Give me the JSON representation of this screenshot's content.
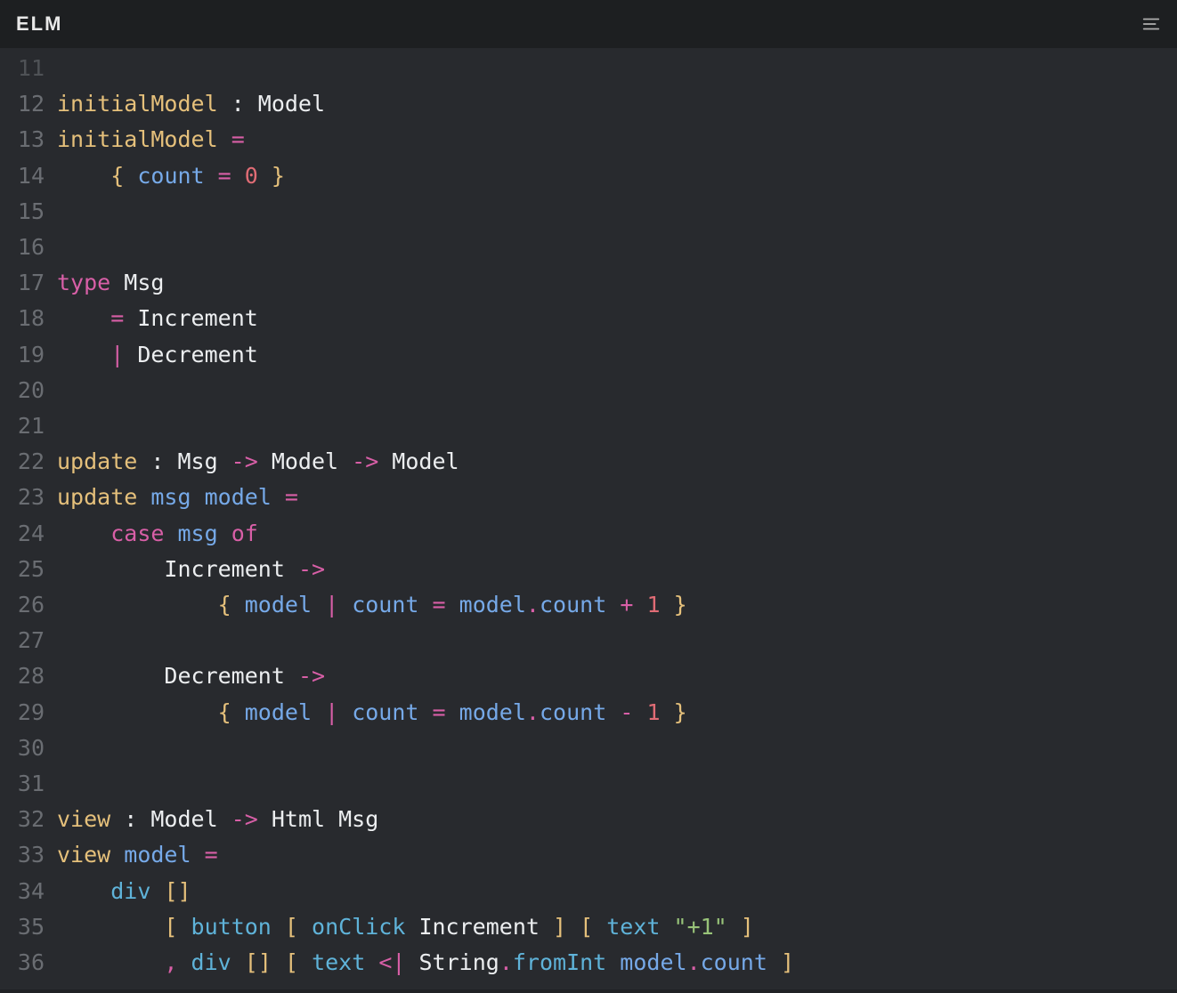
{
  "header": {
    "title": "ELM"
  },
  "lines": [
    {
      "n": "11",
      "cut": true,
      "tokens": []
    },
    {
      "n": "12",
      "tokens": [
        {
          "c": "c-fn",
          "t": "initialModel"
        },
        {
          "c": "c-plain",
          "t": " : "
        },
        {
          "c": "c-plain",
          "t": "Model"
        }
      ]
    },
    {
      "n": "13",
      "tokens": [
        {
          "c": "c-fn",
          "t": "initialModel"
        },
        {
          "c": "c-plain",
          "t": " "
        },
        {
          "c": "c-op",
          "t": "="
        }
      ]
    },
    {
      "n": "14",
      "tokens": [
        {
          "c": "c-plain",
          "t": "    "
        },
        {
          "c": "c-brace",
          "t": "{"
        },
        {
          "c": "c-plain",
          "t": " "
        },
        {
          "c": "c-param",
          "t": "count"
        },
        {
          "c": "c-plain",
          "t": " "
        },
        {
          "c": "c-op",
          "t": "="
        },
        {
          "c": "c-plain",
          "t": " "
        },
        {
          "c": "c-num",
          "t": "0"
        },
        {
          "c": "c-plain",
          "t": " "
        },
        {
          "c": "c-brace",
          "t": "}"
        }
      ]
    },
    {
      "n": "15",
      "tokens": []
    },
    {
      "n": "16",
      "tokens": []
    },
    {
      "n": "17",
      "tokens": [
        {
          "c": "c-key",
          "t": "type"
        },
        {
          "c": "c-plain",
          "t": " Msg"
        }
      ]
    },
    {
      "n": "18",
      "tokens": [
        {
          "c": "c-plain",
          "t": "    "
        },
        {
          "c": "c-op",
          "t": "="
        },
        {
          "c": "c-plain",
          "t": " Increment"
        }
      ]
    },
    {
      "n": "19",
      "tokens": [
        {
          "c": "c-plain",
          "t": "    "
        },
        {
          "c": "c-op",
          "t": "|"
        },
        {
          "c": "c-plain",
          "t": " Decrement"
        }
      ]
    },
    {
      "n": "20",
      "tokens": []
    },
    {
      "n": "21",
      "tokens": []
    },
    {
      "n": "22",
      "tokens": [
        {
          "c": "c-fn",
          "t": "update"
        },
        {
          "c": "c-plain",
          "t": " : Msg "
        },
        {
          "c": "c-op",
          "t": "->"
        },
        {
          "c": "c-plain",
          "t": " Model "
        },
        {
          "c": "c-op",
          "t": "->"
        },
        {
          "c": "c-plain",
          "t": " Model"
        }
      ]
    },
    {
      "n": "23",
      "tokens": [
        {
          "c": "c-fn",
          "t": "update"
        },
        {
          "c": "c-plain",
          "t": " "
        },
        {
          "c": "c-param",
          "t": "msg"
        },
        {
          "c": "c-plain",
          "t": " "
        },
        {
          "c": "c-param",
          "t": "model"
        },
        {
          "c": "c-plain",
          "t": " "
        },
        {
          "c": "c-op",
          "t": "="
        }
      ]
    },
    {
      "n": "24",
      "tokens": [
        {
          "c": "c-plain",
          "t": "    "
        },
        {
          "c": "c-key",
          "t": "case"
        },
        {
          "c": "c-plain",
          "t": " "
        },
        {
          "c": "c-param",
          "t": "msg"
        },
        {
          "c": "c-plain",
          "t": " "
        },
        {
          "c": "c-key",
          "t": "of"
        }
      ]
    },
    {
      "n": "25",
      "tokens": [
        {
          "c": "c-plain",
          "t": "        Increment "
        },
        {
          "c": "c-op",
          "t": "->"
        }
      ]
    },
    {
      "n": "26",
      "tokens": [
        {
          "c": "c-plain",
          "t": "            "
        },
        {
          "c": "c-brace",
          "t": "{"
        },
        {
          "c": "c-plain",
          "t": " "
        },
        {
          "c": "c-param",
          "t": "model"
        },
        {
          "c": "c-plain",
          "t": " "
        },
        {
          "c": "c-op",
          "t": "|"
        },
        {
          "c": "c-plain",
          "t": " "
        },
        {
          "c": "c-param",
          "t": "count"
        },
        {
          "c": "c-plain",
          "t": " "
        },
        {
          "c": "c-op",
          "t": "="
        },
        {
          "c": "c-plain",
          "t": " "
        },
        {
          "c": "c-param",
          "t": "model"
        },
        {
          "c": "c-op",
          "t": "."
        },
        {
          "c": "c-param",
          "t": "count"
        },
        {
          "c": "c-plain",
          "t": " "
        },
        {
          "c": "c-op",
          "t": "+"
        },
        {
          "c": "c-plain",
          "t": " "
        },
        {
          "c": "c-num",
          "t": "1"
        },
        {
          "c": "c-plain",
          "t": " "
        },
        {
          "c": "c-brace",
          "t": "}"
        }
      ]
    },
    {
      "n": "27",
      "tokens": []
    },
    {
      "n": "28",
      "tokens": [
        {
          "c": "c-plain",
          "t": "        Decrement "
        },
        {
          "c": "c-op",
          "t": "->"
        }
      ]
    },
    {
      "n": "29",
      "tokens": [
        {
          "c": "c-plain",
          "t": "            "
        },
        {
          "c": "c-brace",
          "t": "{"
        },
        {
          "c": "c-plain",
          "t": " "
        },
        {
          "c": "c-param",
          "t": "model"
        },
        {
          "c": "c-plain",
          "t": " "
        },
        {
          "c": "c-op",
          "t": "|"
        },
        {
          "c": "c-plain",
          "t": " "
        },
        {
          "c": "c-param",
          "t": "count"
        },
        {
          "c": "c-plain",
          "t": " "
        },
        {
          "c": "c-op",
          "t": "="
        },
        {
          "c": "c-plain",
          "t": " "
        },
        {
          "c": "c-param",
          "t": "model"
        },
        {
          "c": "c-op",
          "t": "."
        },
        {
          "c": "c-param",
          "t": "count"
        },
        {
          "c": "c-plain",
          "t": " "
        },
        {
          "c": "c-op",
          "t": "-"
        },
        {
          "c": "c-plain",
          "t": " "
        },
        {
          "c": "c-num",
          "t": "1"
        },
        {
          "c": "c-plain",
          "t": " "
        },
        {
          "c": "c-brace",
          "t": "}"
        }
      ]
    },
    {
      "n": "30",
      "tokens": []
    },
    {
      "n": "31",
      "tokens": []
    },
    {
      "n": "32",
      "tokens": [
        {
          "c": "c-fn",
          "t": "view"
        },
        {
          "c": "c-plain",
          "t": " : Model "
        },
        {
          "c": "c-op",
          "t": "->"
        },
        {
          "c": "c-plain",
          "t": " Html Msg"
        }
      ]
    },
    {
      "n": "33",
      "tokens": [
        {
          "c": "c-fn",
          "t": "view"
        },
        {
          "c": "c-plain",
          "t": " "
        },
        {
          "c": "c-param",
          "t": "model"
        },
        {
          "c": "c-plain",
          "t": " "
        },
        {
          "c": "c-op",
          "t": "="
        }
      ]
    },
    {
      "n": "34",
      "tokens": [
        {
          "c": "c-plain",
          "t": "    "
        },
        {
          "c": "c-call",
          "t": "div"
        },
        {
          "c": "c-plain",
          "t": " "
        },
        {
          "c": "c-brace",
          "t": "[]"
        }
      ]
    },
    {
      "n": "35",
      "tokens": [
        {
          "c": "c-plain",
          "t": "        "
        },
        {
          "c": "c-brace",
          "t": "["
        },
        {
          "c": "c-plain",
          "t": " "
        },
        {
          "c": "c-call",
          "t": "button"
        },
        {
          "c": "c-plain",
          "t": " "
        },
        {
          "c": "c-brace",
          "t": "["
        },
        {
          "c": "c-plain",
          "t": " "
        },
        {
          "c": "c-call",
          "t": "onClick"
        },
        {
          "c": "c-plain",
          "t": " Increment "
        },
        {
          "c": "c-brace",
          "t": "]"
        },
        {
          "c": "c-plain",
          "t": " "
        },
        {
          "c": "c-brace",
          "t": "["
        },
        {
          "c": "c-plain",
          "t": " "
        },
        {
          "c": "c-call",
          "t": "text"
        },
        {
          "c": "c-plain",
          "t": " "
        },
        {
          "c": "c-str",
          "t": "\"+1\""
        },
        {
          "c": "c-plain",
          "t": " "
        },
        {
          "c": "c-brace",
          "t": "]"
        }
      ]
    },
    {
      "n": "36",
      "tokens": [
        {
          "c": "c-plain",
          "t": "        "
        },
        {
          "c": "c-op",
          "t": ","
        },
        {
          "c": "c-plain",
          "t": " "
        },
        {
          "c": "c-call",
          "t": "div"
        },
        {
          "c": "c-plain",
          "t": " "
        },
        {
          "c": "c-brace",
          "t": "[]"
        },
        {
          "c": "c-plain",
          "t": " "
        },
        {
          "c": "c-brace",
          "t": "["
        },
        {
          "c": "c-plain",
          "t": " "
        },
        {
          "c": "c-call",
          "t": "text"
        },
        {
          "c": "c-plain",
          "t": " "
        },
        {
          "c": "c-lt",
          "t": "<|"
        },
        {
          "c": "c-plain",
          "t": " String"
        },
        {
          "c": "c-op",
          "t": "."
        },
        {
          "c": "c-call",
          "t": "fromInt"
        },
        {
          "c": "c-plain",
          "t": " "
        },
        {
          "c": "c-param",
          "t": "model"
        },
        {
          "c": "c-op",
          "t": "."
        },
        {
          "c": "c-param",
          "t": "count"
        },
        {
          "c": "c-plain",
          "t": " "
        },
        {
          "c": "c-brace",
          "t": "]"
        }
      ]
    }
  ]
}
